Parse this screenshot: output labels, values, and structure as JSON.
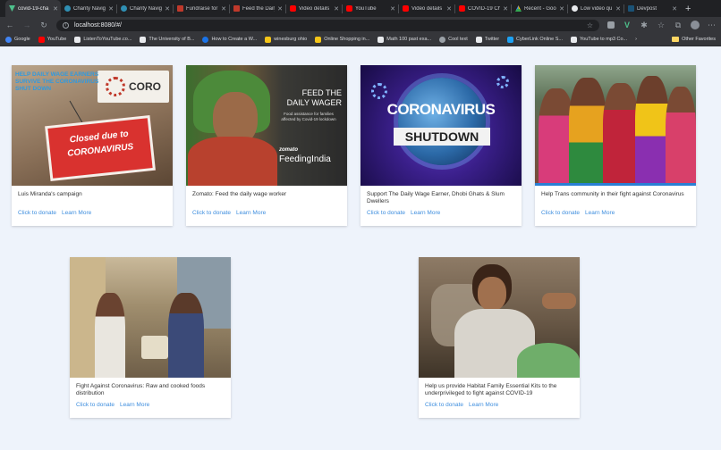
{
  "browser": {
    "tabs": [
      {
        "label": "covid-19-cha",
        "active": true,
        "color": "#4ec08c"
      },
      {
        "label": "Charity Navig",
        "active": false,
        "color": "#2f8fb3"
      },
      {
        "label": "Charity Navig",
        "active": false,
        "color": "#2f8fb3"
      },
      {
        "label": "Fundraise for",
        "active": false,
        "color": "#c0392b"
      },
      {
        "label": "Feed the Daily",
        "active": false,
        "color": "#c0392b"
      },
      {
        "label": "Video details",
        "active": false,
        "color": "#ff0000"
      },
      {
        "label": "YouTube",
        "active": false,
        "color": "#ff0000"
      },
      {
        "label": "Video details",
        "active": false,
        "color": "#ff0000"
      },
      {
        "label": "COVID-19 Ch",
        "active": false,
        "color": "#ff0000"
      },
      {
        "label": "Recent - Goo",
        "active": false,
        "color": "#34a853"
      },
      {
        "label": "Low video qu",
        "active": false,
        "color": "#e8eaed"
      },
      {
        "label": "Devpost",
        "active": false,
        "color": "#1a5276"
      }
    ],
    "url": "localhost:8080/#/",
    "bookmarks": [
      {
        "label": "Google",
        "color": "#4285f4"
      },
      {
        "label": "YouTube",
        "color": "#ff0000"
      },
      {
        "label": "ListenToYouTube.co...",
        "color": "#e8eaed"
      },
      {
        "label": "The University of B...",
        "color": "#e8eaed"
      },
      {
        "label": "How to Create a W...",
        "color": "#1a73e8"
      },
      {
        "label": "winesburg ohio",
        "color": "#f5c518"
      },
      {
        "label": "Online Shopping in...",
        "color": "#f5c518"
      },
      {
        "label": "Math 100 past exa...",
        "color": "#e8eaed"
      },
      {
        "label": "Cool text",
        "color": "#9aa0a6"
      },
      {
        "label": "Twitter",
        "color": "#1da1f2"
      },
      {
        "label": "CyberLink Online S...",
        "color": "#e8eaed"
      },
      {
        "label": "YouTube to mp3 Co...",
        "color": "#e8eaed"
      }
    ],
    "other_bookmarks": "Other Favorites"
  },
  "image_text": {
    "wage_banner": "HELP DAILY WAGE EARNERS SURVIVE THE CORONAVIRUS SHUT DOWN",
    "coro": "CORO",
    "closed_sign": "Closed due to CORONAVIRUS",
    "feed_title": "FEED THE DAILY WAGER",
    "feed_sub": "Food assistance for families affected by Covid-19 lockdown",
    "zomato": "zomato",
    "feeding_india": "FeedingIndia",
    "corona": "CORONAVIRUS",
    "shutdown": "SHUTDOWN"
  },
  "cards": [
    {
      "title": "Luis Miranda's campaign",
      "donate": "Click to donate",
      "learn": "Learn More"
    },
    {
      "title": "Zomato: Feed the daily wage worker",
      "donate": "Click to donate",
      "learn": "Learn More"
    },
    {
      "title": "Support The Daily Wage Earner, Dhobi Ghats & Slum Dwellers",
      "donate": "Click to donate",
      "learn": "Learn More"
    },
    {
      "title": "Help Trans community in their fight against Coronavirus",
      "donate": "Click to donate",
      "learn": "Learn More"
    },
    {
      "title": "Fight Against Coronavirus: Raw and cooked foods distribution",
      "donate": "Click to donate",
      "learn": "Learn More"
    },
    {
      "title": "Help us provide Habitat Family Essential Kits to the underprivileged to fight against COVID-19",
      "donate": "Click to donate",
      "learn": "Learn More"
    }
  ]
}
